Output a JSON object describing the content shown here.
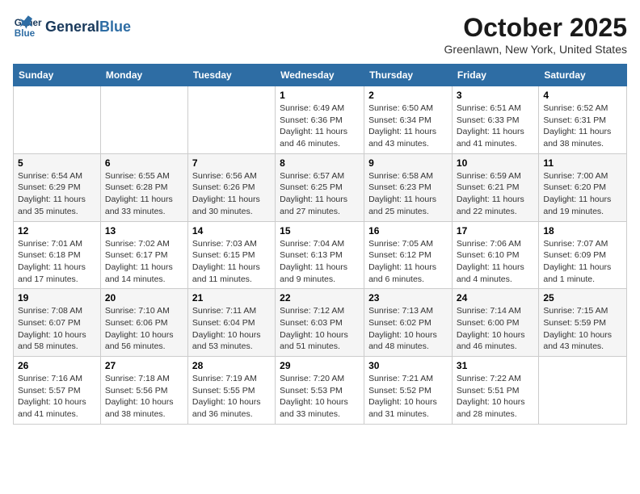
{
  "header": {
    "logo_line1": "General",
    "logo_line2": "Blue",
    "month": "October 2025",
    "location": "Greenlawn, New York, United States"
  },
  "weekdays": [
    "Sunday",
    "Monday",
    "Tuesday",
    "Wednesday",
    "Thursday",
    "Friday",
    "Saturday"
  ],
  "weeks": [
    [
      {
        "day": "",
        "info": ""
      },
      {
        "day": "",
        "info": ""
      },
      {
        "day": "",
        "info": ""
      },
      {
        "day": "1",
        "info": "Sunrise: 6:49 AM\nSunset: 6:36 PM\nDaylight: 11 hours and 46 minutes."
      },
      {
        "day": "2",
        "info": "Sunrise: 6:50 AM\nSunset: 6:34 PM\nDaylight: 11 hours and 43 minutes."
      },
      {
        "day": "3",
        "info": "Sunrise: 6:51 AM\nSunset: 6:33 PM\nDaylight: 11 hours and 41 minutes."
      },
      {
        "day": "4",
        "info": "Sunrise: 6:52 AM\nSunset: 6:31 PM\nDaylight: 11 hours and 38 minutes."
      }
    ],
    [
      {
        "day": "5",
        "info": "Sunrise: 6:54 AM\nSunset: 6:29 PM\nDaylight: 11 hours and 35 minutes."
      },
      {
        "day": "6",
        "info": "Sunrise: 6:55 AM\nSunset: 6:28 PM\nDaylight: 11 hours and 33 minutes."
      },
      {
        "day": "7",
        "info": "Sunrise: 6:56 AM\nSunset: 6:26 PM\nDaylight: 11 hours and 30 minutes."
      },
      {
        "day": "8",
        "info": "Sunrise: 6:57 AM\nSunset: 6:25 PM\nDaylight: 11 hours and 27 minutes."
      },
      {
        "day": "9",
        "info": "Sunrise: 6:58 AM\nSunset: 6:23 PM\nDaylight: 11 hours and 25 minutes."
      },
      {
        "day": "10",
        "info": "Sunrise: 6:59 AM\nSunset: 6:21 PM\nDaylight: 11 hours and 22 minutes."
      },
      {
        "day": "11",
        "info": "Sunrise: 7:00 AM\nSunset: 6:20 PM\nDaylight: 11 hours and 19 minutes."
      }
    ],
    [
      {
        "day": "12",
        "info": "Sunrise: 7:01 AM\nSunset: 6:18 PM\nDaylight: 11 hours and 17 minutes."
      },
      {
        "day": "13",
        "info": "Sunrise: 7:02 AM\nSunset: 6:17 PM\nDaylight: 11 hours and 14 minutes."
      },
      {
        "day": "14",
        "info": "Sunrise: 7:03 AM\nSunset: 6:15 PM\nDaylight: 11 hours and 11 minutes."
      },
      {
        "day": "15",
        "info": "Sunrise: 7:04 AM\nSunset: 6:13 PM\nDaylight: 11 hours and 9 minutes."
      },
      {
        "day": "16",
        "info": "Sunrise: 7:05 AM\nSunset: 6:12 PM\nDaylight: 11 hours and 6 minutes."
      },
      {
        "day": "17",
        "info": "Sunrise: 7:06 AM\nSunset: 6:10 PM\nDaylight: 11 hours and 4 minutes."
      },
      {
        "day": "18",
        "info": "Sunrise: 7:07 AM\nSunset: 6:09 PM\nDaylight: 11 hours and 1 minute."
      }
    ],
    [
      {
        "day": "19",
        "info": "Sunrise: 7:08 AM\nSunset: 6:07 PM\nDaylight: 10 hours and 58 minutes."
      },
      {
        "day": "20",
        "info": "Sunrise: 7:10 AM\nSunset: 6:06 PM\nDaylight: 10 hours and 56 minutes."
      },
      {
        "day": "21",
        "info": "Sunrise: 7:11 AM\nSunset: 6:04 PM\nDaylight: 10 hours and 53 minutes."
      },
      {
        "day": "22",
        "info": "Sunrise: 7:12 AM\nSunset: 6:03 PM\nDaylight: 10 hours and 51 minutes."
      },
      {
        "day": "23",
        "info": "Sunrise: 7:13 AM\nSunset: 6:02 PM\nDaylight: 10 hours and 48 minutes."
      },
      {
        "day": "24",
        "info": "Sunrise: 7:14 AM\nSunset: 6:00 PM\nDaylight: 10 hours and 46 minutes."
      },
      {
        "day": "25",
        "info": "Sunrise: 7:15 AM\nSunset: 5:59 PM\nDaylight: 10 hours and 43 minutes."
      }
    ],
    [
      {
        "day": "26",
        "info": "Sunrise: 7:16 AM\nSunset: 5:57 PM\nDaylight: 10 hours and 41 minutes."
      },
      {
        "day": "27",
        "info": "Sunrise: 7:18 AM\nSunset: 5:56 PM\nDaylight: 10 hours and 38 minutes."
      },
      {
        "day": "28",
        "info": "Sunrise: 7:19 AM\nSunset: 5:55 PM\nDaylight: 10 hours and 36 minutes."
      },
      {
        "day": "29",
        "info": "Sunrise: 7:20 AM\nSunset: 5:53 PM\nDaylight: 10 hours and 33 minutes."
      },
      {
        "day": "30",
        "info": "Sunrise: 7:21 AM\nSunset: 5:52 PM\nDaylight: 10 hours and 31 minutes."
      },
      {
        "day": "31",
        "info": "Sunrise: 7:22 AM\nSunset: 5:51 PM\nDaylight: 10 hours and 28 minutes."
      },
      {
        "day": "",
        "info": ""
      }
    ]
  ]
}
